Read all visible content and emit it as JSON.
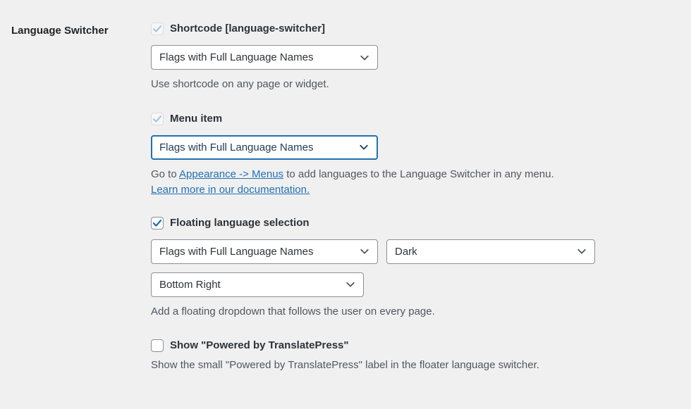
{
  "section": {
    "label": "Language Switcher"
  },
  "colors": {
    "background": "#f0f0f1",
    "link": "#2271b1",
    "focus_border": "#2271b1",
    "checkbox_checked": "#2271b1",
    "checkbox_disabled_check": "#a7c1dd",
    "label_text": "#2c3338",
    "description_text": "#50575e"
  },
  "options": {
    "shortcode": {
      "checkbox": {
        "label": "Shortcode [language-switcher]",
        "checked": true,
        "disabled": true,
        "icon": "check-icon"
      },
      "select": {
        "value": "Flags with Full Language Names",
        "icon": "chevron-down-icon",
        "focused": false
      },
      "description": "Use shortcode on any page or widget."
    },
    "menu_item": {
      "checkbox": {
        "label": "Menu item",
        "checked": true,
        "disabled": true,
        "icon": "check-icon"
      },
      "select": {
        "value": "Flags with Full Language Names",
        "icon": "chevron-down-icon",
        "focused": true
      },
      "description_before_link": "Go to ",
      "description_link": "Appearance -> Menus",
      "description_after_link": " to add languages to the Language Switcher in any menu.",
      "documentation_link": "Learn more in our documentation."
    },
    "floating": {
      "checkbox": {
        "label": "Floating language selection",
        "checked": true,
        "disabled": false,
        "icon": "check-icon"
      },
      "select_style": {
        "value": "Flags with Full Language Names",
        "icon": "chevron-down-icon"
      },
      "select_theme": {
        "value": "Dark",
        "icon": "chevron-down-icon"
      },
      "select_position": {
        "value": "Bottom Right",
        "icon": "chevron-down-icon"
      },
      "description": "Add a floating dropdown that follows the user on every page."
    },
    "powered_by": {
      "checkbox": {
        "label": "Show \"Powered by TranslatePress\"",
        "checked": false,
        "disabled": false,
        "icon": "checkbox-empty-icon"
      },
      "description": "Show the small \"Powered by TranslatePress\" label in the floater language switcher."
    }
  }
}
